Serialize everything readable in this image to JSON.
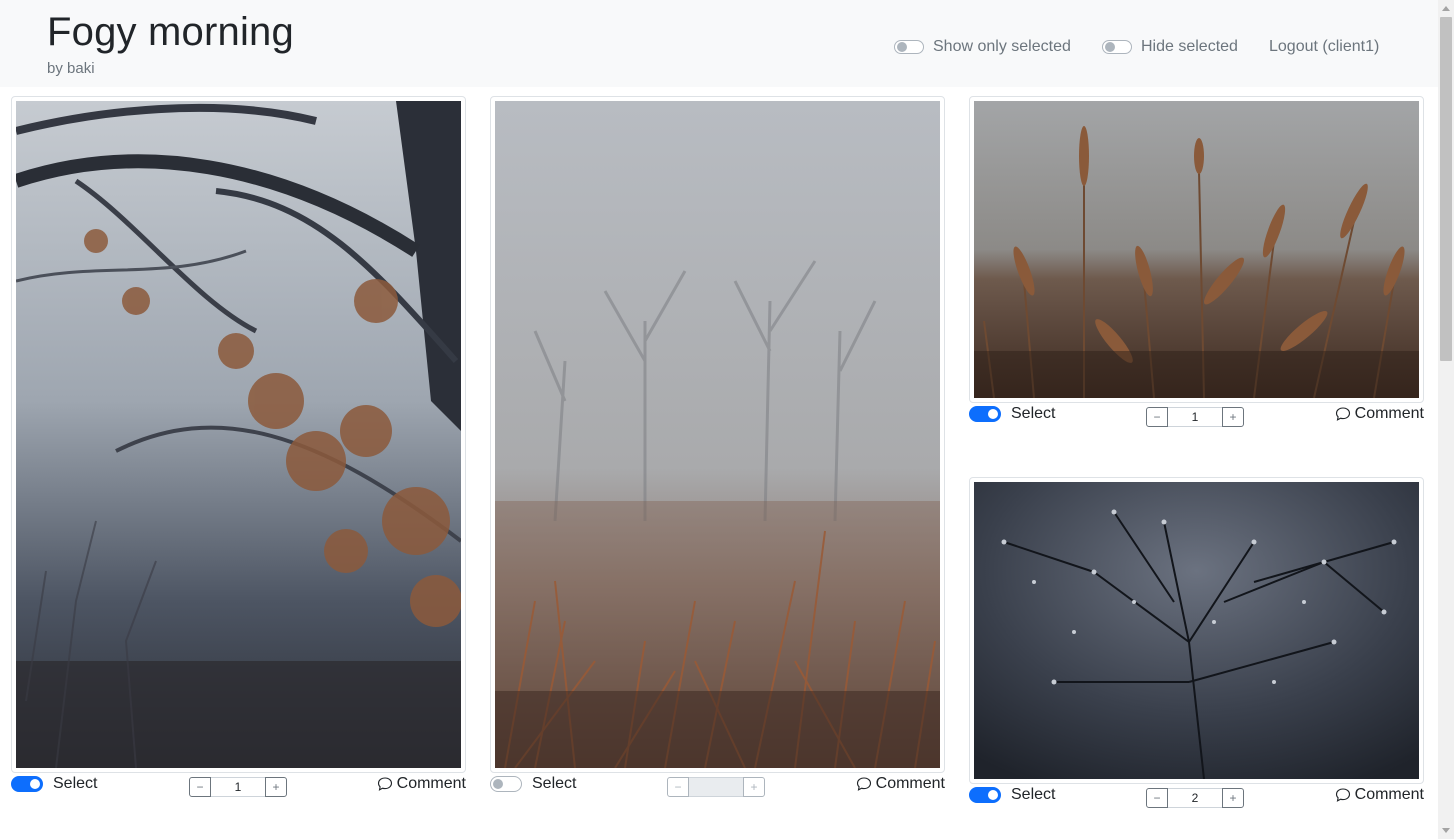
{
  "header": {
    "title": "Fogy morning",
    "subtitle": "by baki",
    "show_only_selected": {
      "label": "Show only selected",
      "on": false
    },
    "hide_selected": {
      "label": "Hide selected",
      "on": false
    },
    "logout": "Logout (client1)"
  },
  "photos": [
    {
      "description": "misty forest with autumn oak branches",
      "select_label": "Select",
      "selected": true,
      "quantity": "1",
      "stepper_minus": "−",
      "stepper_plus": "+",
      "comment_label": "Comment"
    },
    {
      "description": "foggy field with bare trees and rust reeds",
      "select_label": "Select",
      "selected": false,
      "quantity": "",
      "stepper_minus": "−",
      "stepper_plus": "+",
      "comment_label": "Comment"
    },
    {
      "description": "dry grass seed heads in fog",
      "select_label": "Select",
      "selected": true,
      "quantity": "1",
      "stepper_minus": "−",
      "stepper_plus": "+",
      "comment_label": "Comment"
    },
    {
      "description": "dew drops on twig branches, dark blue",
      "select_label": "Select",
      "selected": true,
      "quantity": "2",
      "stepper_minus": "−",
      "stepper_plus": "+",
      "comment_label": "Comment"
    }
  ],
  "colors": {
    "accent": "#0d6efd",
    "muted": "#6c757d",
    "header_bg": "#f8f9fa"
  }
}
